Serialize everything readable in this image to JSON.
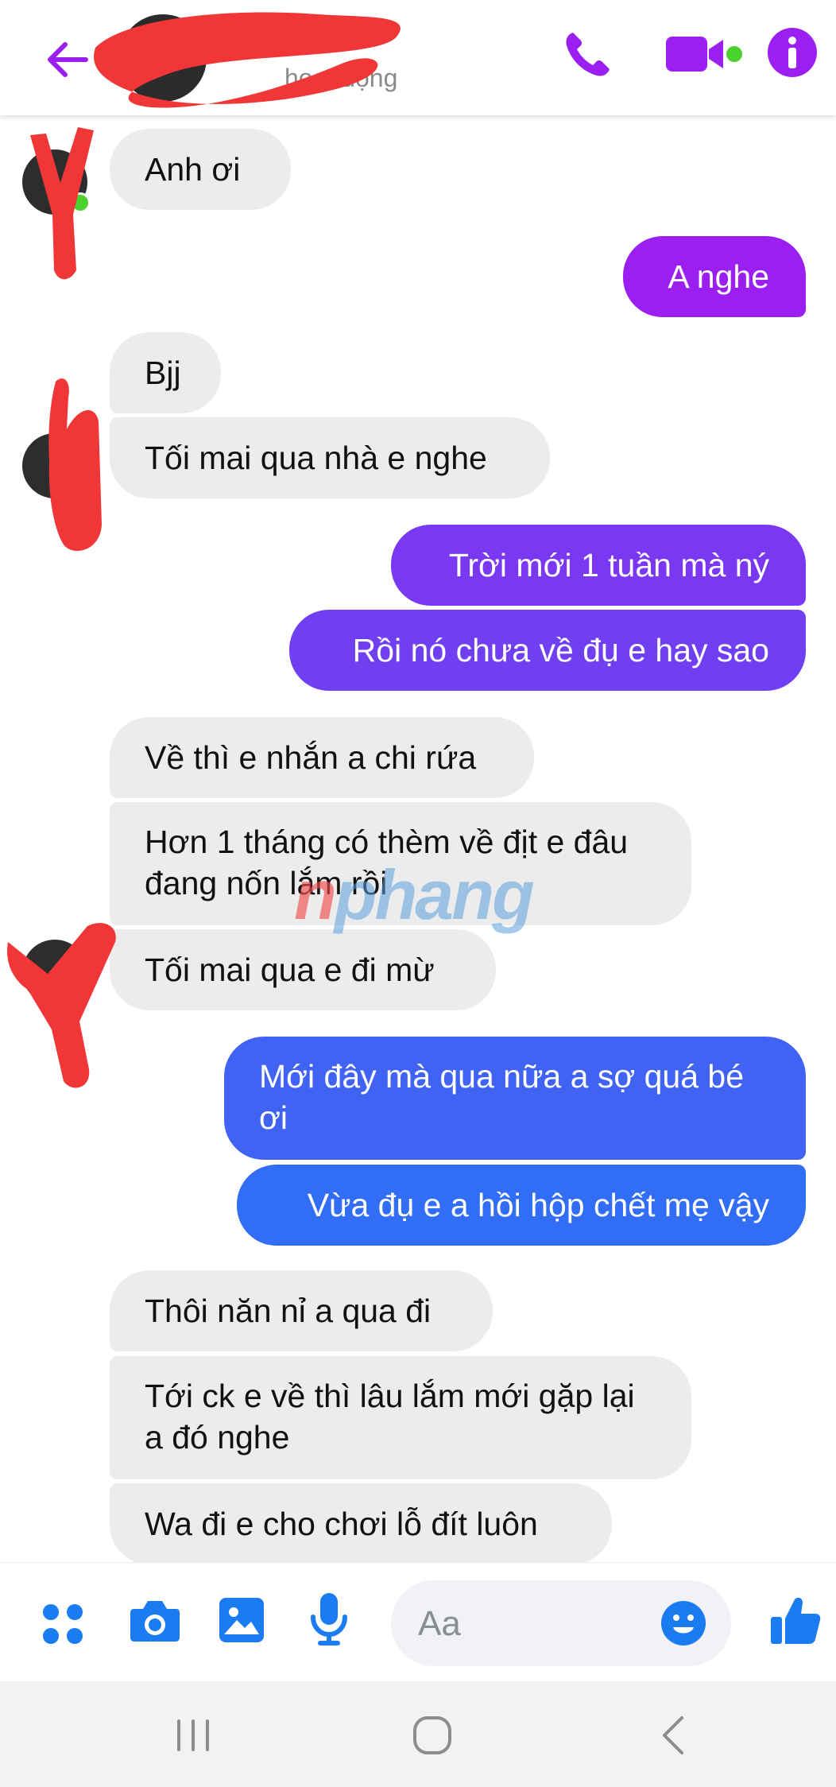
{
  "header": {
    "contact_name": "",
    "status": "hoạt động",
    "back_icon": "arrow-left-icon",
    "call_icon": "phone-icon",
    "video_icon": "video-camera-icon",
    "info_icon": "info-icon",
    "accent_color": "#9b1ff0"
  },
  "messages": [
    {
      "side": "in",
      "text": "Anh ơi"
    },
    {
      "side": "out",
      "text": "A nghe"
    },
    {
      "side": "in",
      "text": "Bjj"
    },
    {
      "side": "in",
      "text": "Tối mai qua nhà e nghe"
    },
    {
      "side": "out",
      "text": "Trời mới 1 tuần mà ný"
    },
    {
      "side": "out",
      "text": "Rồi nó chưa về đụ e hay sao"
    },
    {
      "side": "in",
      "text": "Về thì e nhắn a chi rứa"
    },
    {
      "side": "in",
      "text": "Hơn 1 tháng có thèm về địt e đâu đang nốn lắm rồi"
    },
    {
      "side": "in",
      "text": "Tối mai qua e đi mừ"
    },
    {
      "side": "out",
      "text": "Mới đây mà qua nữa a sợ quá bé ơi"
    },
    {
      "side": "out",
      "text": "Vừa đụ e a hồi hộp chết mẹ vậy"
    },
    {
      "side": "in",
      "text": "Thôi năn nỉ a qua đi"
    },
    {
      "side": "in",
      "text": "Tới ck e về thì lâu lắm mới gặp lại a đó nghe"
    },
    {
      "side": "in",
      "text": "Wa đi e cho chơi lỗ đít luôn"
    }
  ],
  "watermark": {
    "first": "n",
    "rest": "phang"
  },
  "composer": {
    "placeholder": "Aa",
    "icons": [
      "apps-grid-icon",
      "camera-icon",
      "gallery-icon",
      "microphone-icon",
      "emoji-icon",
      "thumbs-up-icon"
    ]
  },
  "navbar": {
    "icons": [
      "recent-apps-icon",
      "home-icon",
      "back-nav-icon"
    ]
  },
  "colors": {
    "incoming_bubble": "#ececec",
    "outgoing_gradient_top": "#9b1ff0",
    "outgoing_gradient_bottom": "#2f6ff5",
    "icon_blue": "#1b7cf2"
  }
}
